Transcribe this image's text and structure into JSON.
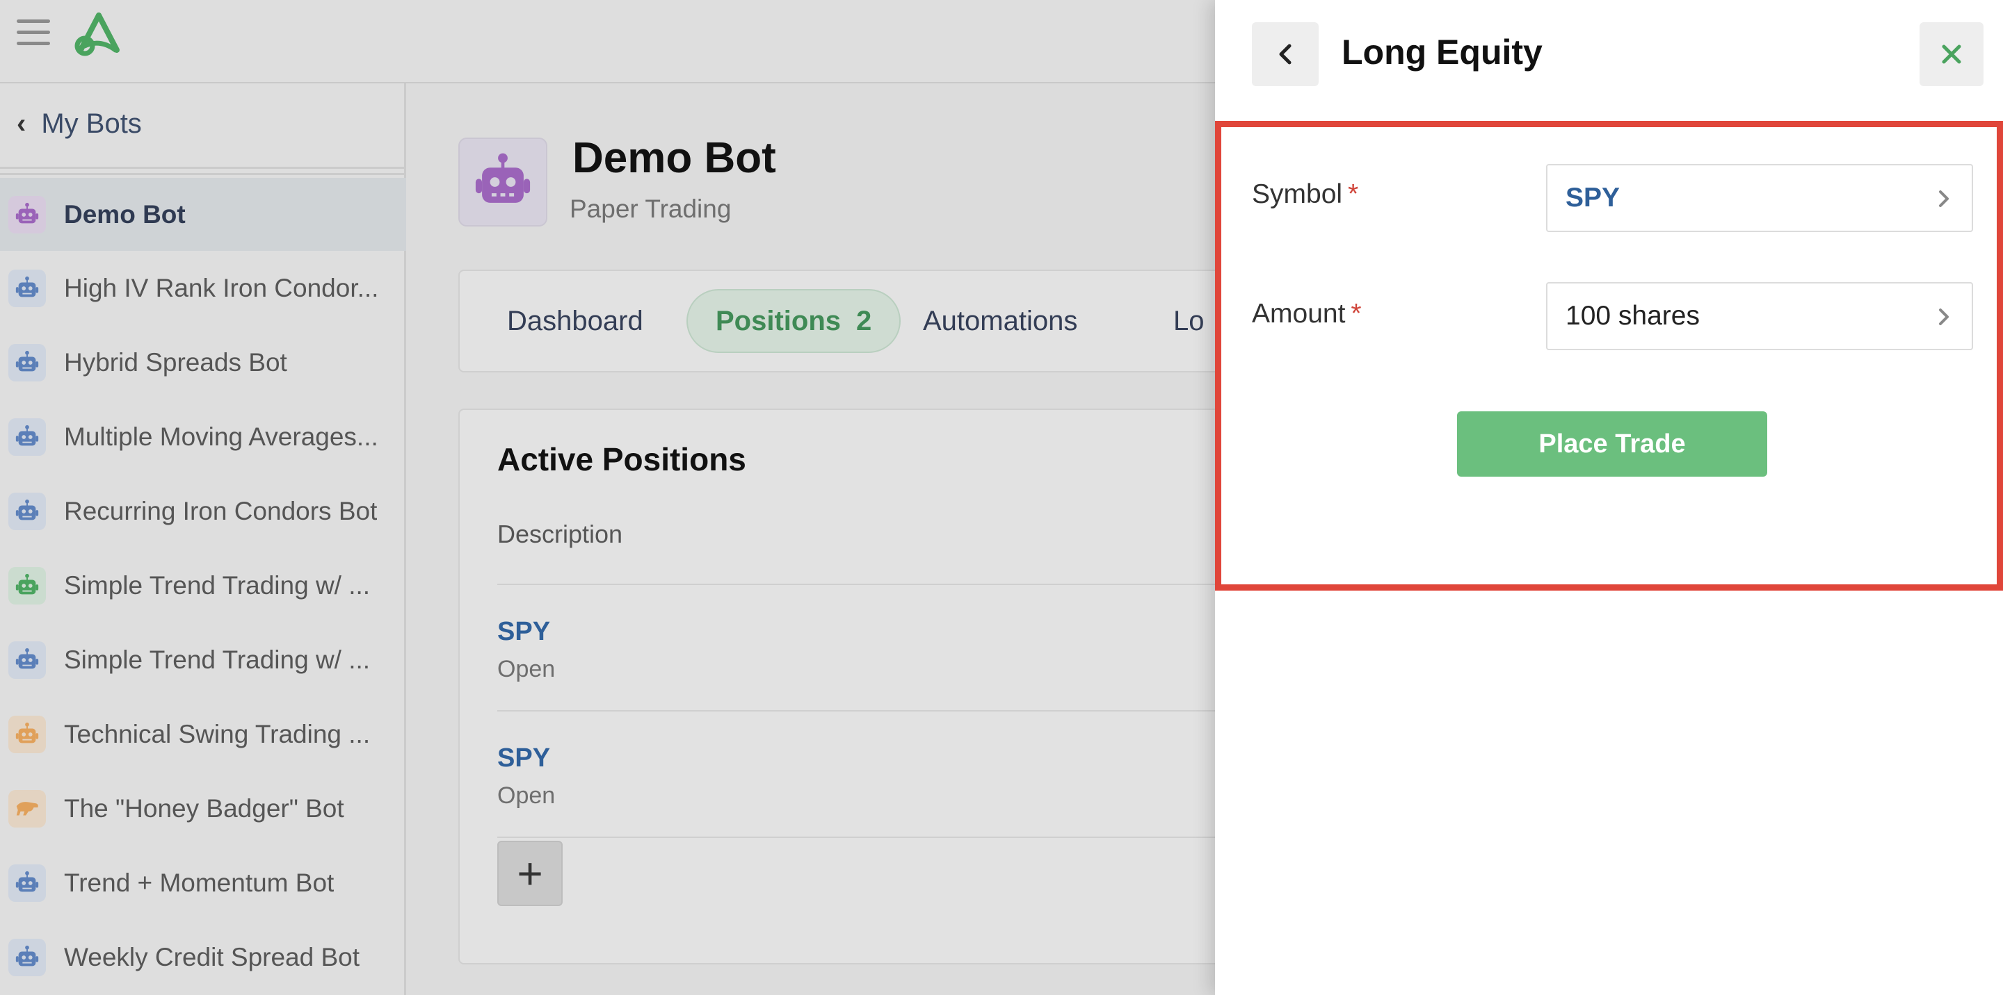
{
  "sidebar": {
    "back_label": "My Bots",
    "bots": [
      {
        "label": "Demo Bot",
        "color": "#9a63b8",
        "bg": "#d5c9dc",
        "icon": "robot-icon"
      },
      {
        "label": "High IV Rank Iron Condor...",
        "color": "#5b7fb8",
        "bg": "#cdd4df",
        "icon": "robot-icon"
      },
      {
        "label": "Hybrid Spreads Bot",
        "color": "#5b7fb8",
        "bg": "#cdd4df",
        "icon": "robot-icon"
      },
      {
        "label": "Multiple Moving Averages...",
        "color": "#5b7fb8",
        "bg": "#cdd4df",
        "icon": "robot-icon"
      },
      {
        "label": "Recurring Iron Condors Bot",
        "color": "#5b7fb8",
        "bg": "#cdd4df",
        "icon": "robot-icon"
      },
      {
        "label": "Simple Trend Trading w/ ...",
        "color": "#4aa35e",
        "bg": "#cbdccf",
        "icon": "robot-icon"
      },
      {
        "label": "Simple Trend Trading w/ ...",
        "color": "#5b7fb8",
        "bg": "#cdd4df",
        "icon": "robot-icon"
      },
      {
        "label": "Technical Swing Trading ...",
        "color": "#e0a05a",
        "bg": "#e3d3c1",
        "icon": "robot-icon"
      },
      {
        "label": "The \"Honey Badger\" Bot",
        "color": "#e0a05a",
        "bg": "#e3d3c1",
        "icon": "badger-icon"
      },
      {
        "label": "Trend + Momentum Bot",
        "color": "#5b7fb8",
        "bg": "#cdd4df",
        "icon": "robot-icon"
      },
      {
        "label": "Weekly Credit Spread Bot",
        "color": "#5b7fb8",
        "bg": "#cdd4df",
        "icon": "robot-icon"
      }
    ]
  },
  "main": {
    "title": "Demo Bot",
    "subtitle": "Paper Trading",
    "tabs": {
      "dashboard": "Dashboard",
      "positions": "Positions",
      "positions_count": "2",
      "automations": "Automations",
      "logs_partial": "Lo"
    },
    "positions_card": {
      "title": "Active Positions",
      "column": "Description",
      "rows": [
        {
          "symbol": "SPY",
          "status": "Open"
        },
        {
          "symbol": "SPY",
          "status": "Open"
        }
      ],
      "add_label": "+"
    }
  },
  "panel": {
    "title": "Long Equity",
    "fields": {
      "symbol_label": "Symbol",
      "symbol_value": "SPY",
      "amount_label": "Amount",
      "amount_value": "100 shares",
      "required_mark": "*"
    },
    "submit_label": "Place Trade"
  },
  "colors": {
    "accent_green": "#6bbf7e",
    "highlight_red": "#e0463a",
    "link_blue": "#2e5f99"
  }
}
